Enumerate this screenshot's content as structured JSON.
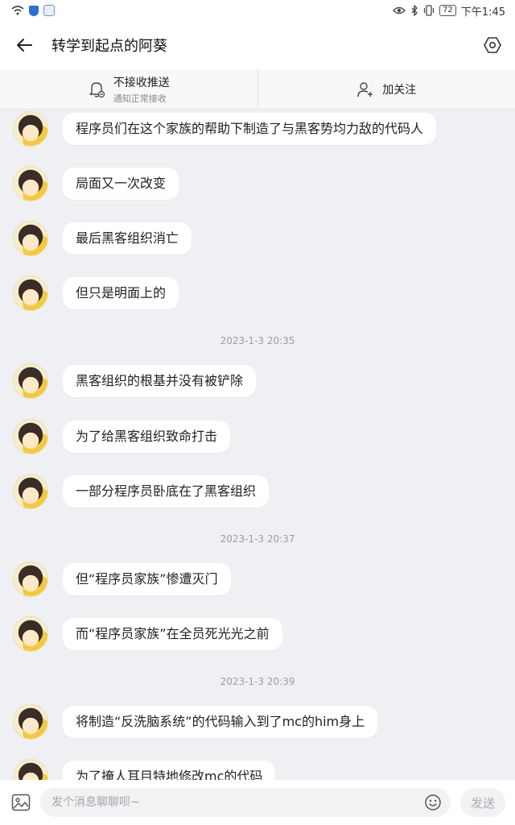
{
  "status_bar": {
    "time": "下午1:45",
    "battery": "72"
  },
  "header": {
    "title": "转学到起点的阿葵"
  },
  "actions": {
    "no_push": {
      "label": "不接收推送",
      "sublabel": "通知正常接收"
    },
    "follow": {
      "label": "加关注"
    }
  },
  "messages": [
    {
      "text": "程序员们在这个家族的帮助下制造了与黑客势均力敌的代码人"
    },
    {
      "text": "局面又一次改变"
    },
    {
      "text": "最后黑客组织消亡"
    },
    {
      "text": "但只是明面上的"
    },
    {
      "text": "黑客组织的根基并没有被铲除"
    },
    {
      "text": "为了给黑客组织致命打击"
    },
    {
      "text": "一部分程序员卧底在了黑客组织"
    },
    {
      "text": "但“程序员家族”惨遭灭门"
    },
    {
      "text": "而“程序员家族”在全员死光光之前"
    },
    {
      "text": "将制造“反洗脑系统”的代码输入到了mc的him身上"
    },
    {
      "text": "为了掩人耳目特地修改mc的代码"
    }
  ],
  "timestamps": [
    "2023-1-3 20:35",
    "2023-1-3 20:37",
    "2023-1-3 20:39"
  ],
  "input": {
    "placeholder": "发个消息聊聊呗~",
    "send_label": "发送"
  }
}
